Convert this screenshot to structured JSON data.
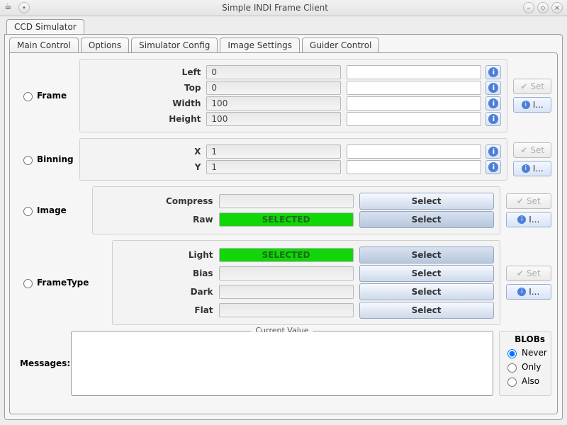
{
  "window": {
    "title": "Simple INDI Frame Client"
  },
  "outer_tab": "CCD Simulator",
  "tabs": [
    "Main Control",
    "Options",
    "Simulator Config",
    "Image Settings",
    "Guider Control"
  ],
  "active_tab": "Image Settings",
  "frame": {
    "name": "Frame",
    "rows": [
      {
        "label": "Left",
        "value": "0"
      },
      {
        "label": "Top",
        "value": "0"
      },
      {
        "label": "Width",
        "value": "100"
      },
      {
        "label": "Height",
        "value": "100"
      }
    ]
  },
  "binning": {
    "name": "Binning",
    "rows": [
      {
        "label": "X",
        "value": "1"
      },
      {
        "label": "Y",
        "value": "1"
      }
    ]
  },
  "image": {
    "name": "Image",
    "rows": [
      {
        "label": "Compress",
        "selected": false
      },
      {
        "label": "Raw",
        "selected": true
      }
    ]
  },
  "frametype": {
    "name": "FrameType",
    "rows": [
      {
        "label": "Light",
        "selected": true
      },
      {
        "label": "Bias",
        "selected": false
      },
      {
        "label": "Dark",
        "selected": false
      },
      {
        "label": "Flat",
        "selected": false
      }
    ]
  },
  "labels": {
    "set": "Set",
    "info": "I...",
    "select": "Select",
    "selected": "SELECTED",
    "messages": "Messages:",
    "current_value": "Current Value",
    "blobs": "BLOBs",
    "never": "Never",
    "only": "Only",
    "also": "Also"
  }
}
